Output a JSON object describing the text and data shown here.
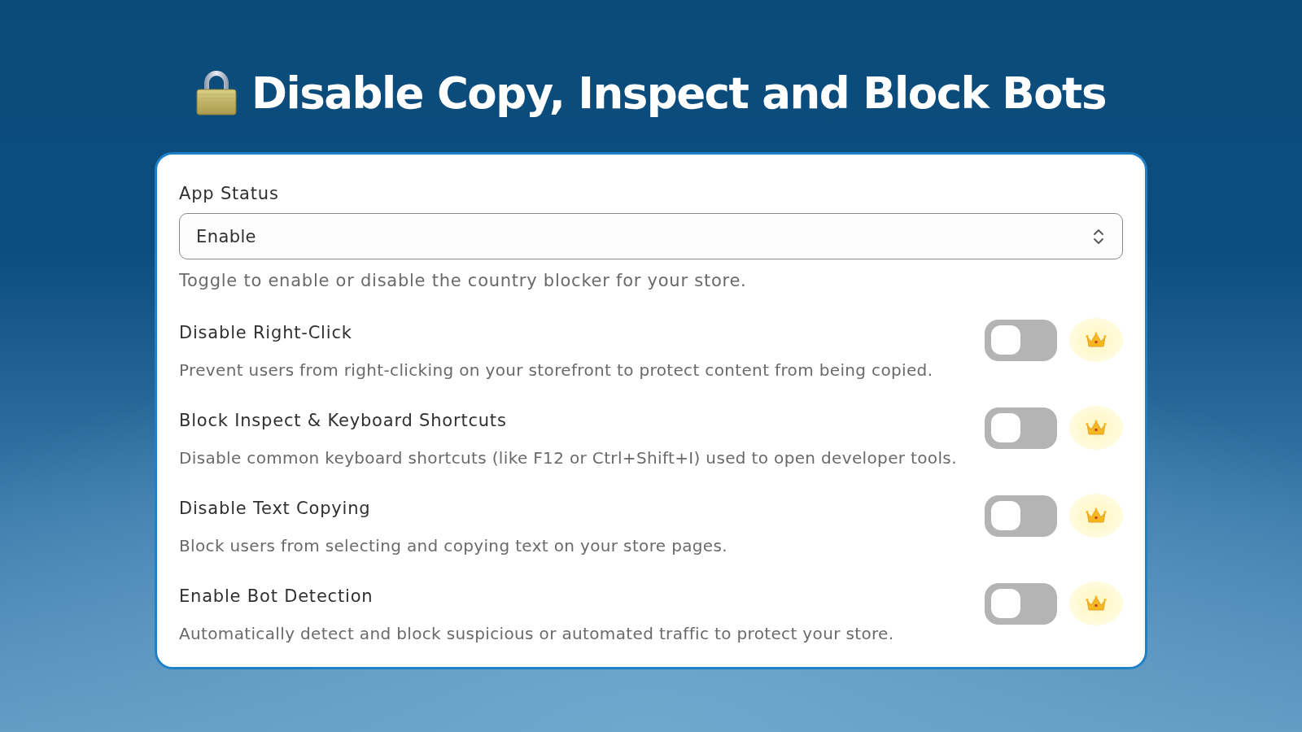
{
  "title": {
    "text": "Disable Copy, Inspect and Block Bots"
  },
  "app_status": {
    "label": "App Status",
    "value": "Enable",
    "help": "Toggle to enable or disable the country blocker for your store."
  },
  "settings": [
    {
      "title": "Disable Right-Click",
      "description": "Prevent users from right-clicking on your storefront to protect content from being copied.",
      "on": false,
      "premium": true
    },
    {
      "title": "Block Inspect & Keyboard Shortcuts",
      "description": "Disable common keyboard shortcuts (like F12 or Ctrl+Shift+I) used to open developer tools.",
      "on": false,
      "premium": true
    },
    {
      "title": "Disable Text Copying",
      "description": "Block users from selecting and copying text on your store pages.",
      "on": false,
      "premium": true
    },
    {
      "title": "Enable Bot Detection",
      "description": "Automatically detect and block suspicious or automated traffic to protect your store.",
      "on": false,
      "premium": true
    }
  ]
}
